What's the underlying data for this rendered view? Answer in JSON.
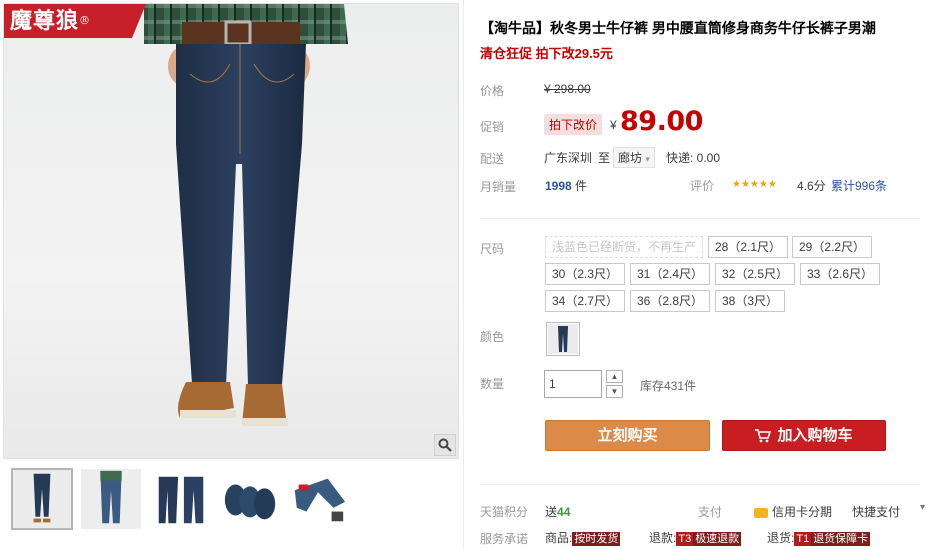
{
  "brand_badge": {
    "name": "魔尊狼",
    "reg_mark": "®"
  },
  "product": {
    "title": "【淘牛品】秋冬男士牛仔裤 男中腰直筒修身商务牛仔长裤子男潮",
    "subtitle": "清仓狂促 拍下改29.5元"
  },
  "price": {
    "label": "价格",
    "original": "¥ 298.00",
    "promo_label": "促销",
    "promo_tag": "拍下改价",
    "yen": "¥",
    "current": "89.00"
  },
  "shipping": {
    "label": "配送",
    "from": "广东深圳",
    "to_word": "至",
    "destination": "廊坊",
    "fee": "快递: 0.00"
  },
  "sales": {
    "label": "月销量",
    "count": "1998",
    "unit": "件",
    "rating_label": "评价",
    "stars": "★★★★★",
    "score": "4.6分",
    "reviews": "累计996条"
  },
  "size": {
    "label": "尺码",
    "options": [
      {
        "text": "浅蓝色已经断货，不再生产",
        "disabled": true
      },
      {
        "text": "28（2.1尺）"
      },
      {
        "text": "29（2.2尺）"
      },
      {
        "text": "30（2.3尺）"
      },
      {
        "text": "31（2.4尺）"
      },
      {
        "text": "32（2.5尺）"
      },
      {
        "text": "33（2.6尺）"
      },
      {
        "text": "34（2.7尺）"
      },
      {
        "text": "36（2.8尺）"
      },
      {
        "text": "38（3尺）"
      }
    ]
  },
  "color": {
    "label": "颜色"
  },
  "quantity": {
    "label": "数量",
    "value": "1",
    "stock": "库存431件"
  },
  "buttons": {
    "buy_now": "立刻购买",
    "add_cart": "加入购物车"
  },
  "footer": {
    "points_label": "天猫积分",
    "points_prefix": "送",
    "points_value": "44",
    "pay_label": "支付",
    "credit": "信用卡分期",
    "quick_pay": "快捷支付",
    "service_label": "服务承诺",
    "goods_label": "商品:",
    "goods_badge": "按时发货",
    "refund_label": "退款:",
    "refund_code": "T3",
    "refund_badge": "极速退款",
    "return_label": "退货:",
    "return_code": "T1",
    "return_badge": "退货保障卡"
  },
  "colors": {
    "accent_red": "#c40000",
    "buy_orange": "#db8a47",
    "cart_red": "#c81e21"
  }
}
